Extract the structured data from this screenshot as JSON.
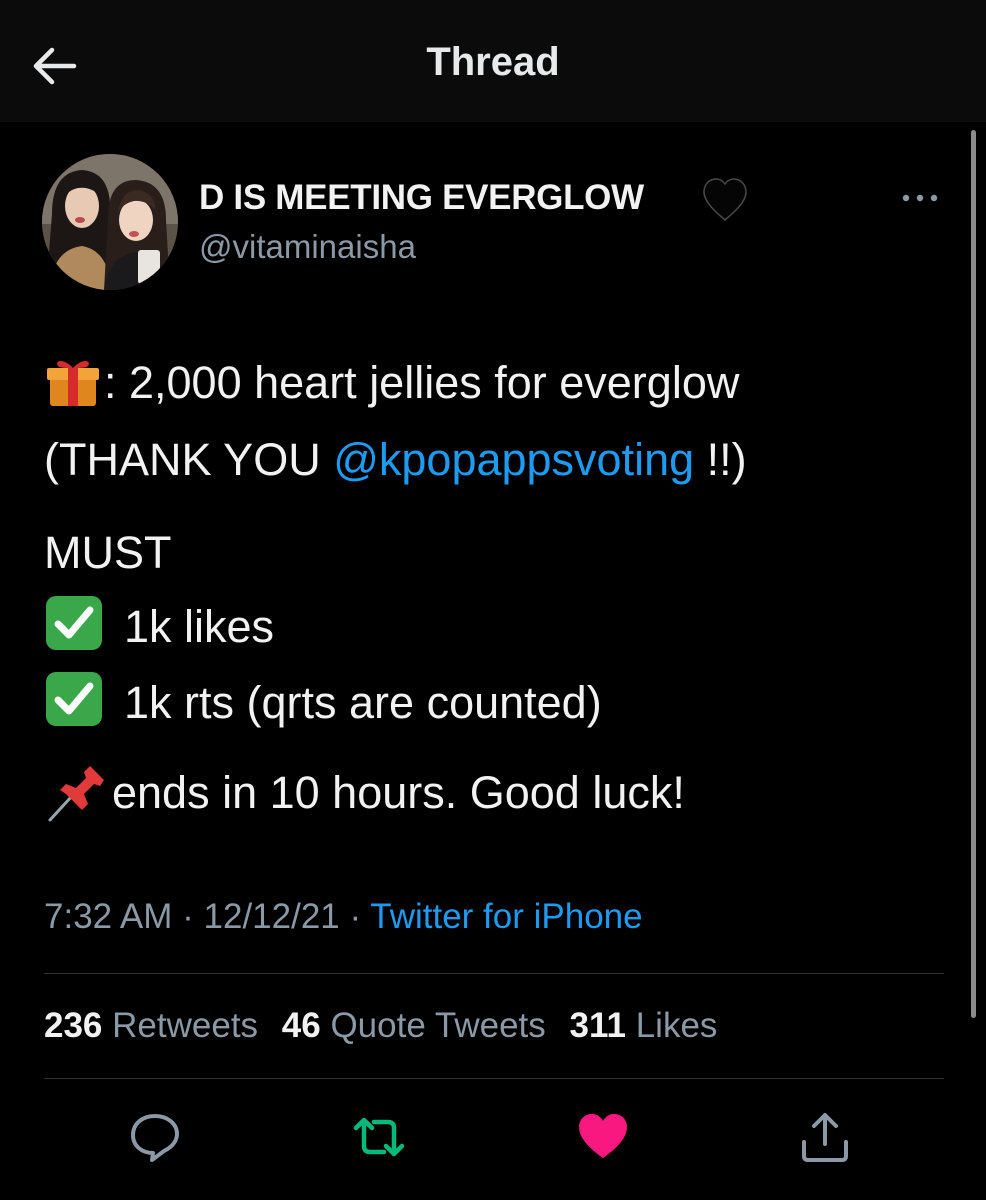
{
  "header": {
    "title": "Thread",
    "back_icon": "arrow-left-icon"
  },
  "tweet": {
    "display_name": "D IS MEETING EVERGLOW",
    "name_emoji": "black-heart",
    "handle": "@vitaminaisha",
    "line1_text": ": 2,000 heart jellies for everglow",
    "line2_prefix": "(THANK YOU ",
    "line2_mention": "@kpopappsvoting",
    "line2_suffix": " !!)",
    "line3_text": "MUST",
    "check1_text": "1k likes",
    "check2_text": "1k rts (qrts are counted)",
    "pin_text": "ends in 10 hours. Good luck!",
    "time": "7:32 AM",
    "separator": " · ",
    "date": "12/12/21",
    "source": "Twitter for iPhone"
  },
  "stats": {
    "retweets_count": "236",
    "retweets_label": "Retweets",
    "quotes_count": "46",
    "quotes_label": "Quote Tweets",
    "likes_count": "311",
    "likes_label": "Likes"
  },
  "actions": [
    "reply-icon",
    "retweet-icon",
    "like-icon",
    "share-icon"
  ],
  "colors": {
    "background": "#000000",
    "link": "#1d9bf0",
    "muted": "#8b98a5",
    "retweet_green": "#00ba7c",
    "like_pink": "#f91880"
  }
}
